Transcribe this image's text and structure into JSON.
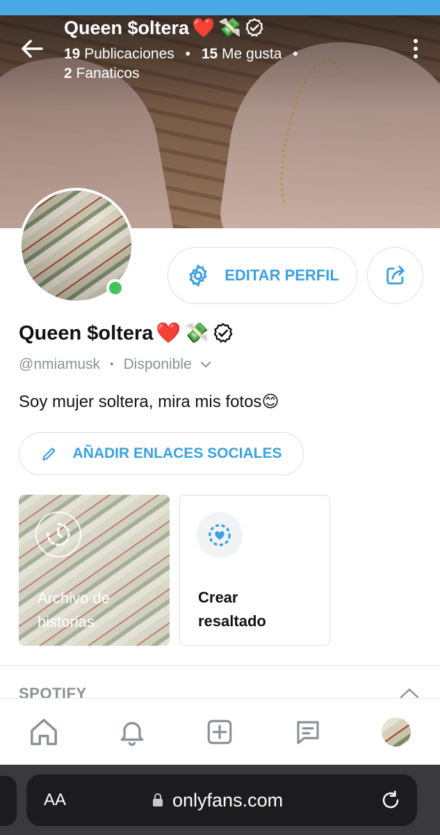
{
  "colors": {
    "accent": "#3ba0e0",
    "online": "#45c45b",
    "muted": "#8a9197"
  },
  "header": {
    "name": "Queen $oltera",
    "posts_count": "19",
    "posts_label": "Publicaciones",
    "likes_count": "15",
    "likes_label": "Me gusta",
    "fans_count": "2",
    "fans_label": "Fanaticos"
  },
  "profile": {
    "name": "Queen $oltera",
    "emoji_heart": "❤️",
    "emoji_money": "💸",
    "handle": "@nmiamusk",
    "status": "Disponible",
    "bio": "Soy mujer soltera, mira mis fotos",
    "bio_emoji": "😊"
  },
  "buttons": {
    "edit_profile": "EDITAR PERFIL",
    "add_social": "AÑADIR ENLACES SOCIALES"
  },
  "cards": {
    "archive_line1": "Archivo de",
    "archive_line2": "historias",
    "highlight_line1": "Crear",
    "highlight_line2": "resaltado"
  },
  "sections": {
    "spotify": "SPOTIFY"
  },
  "nav": [
    "home-icon",
    "bell-icon",
    "add-post-icon",
    "messages-icon",
    "profile-avatar"
  ],
  "browser": {
    "text_size": "AA",
    "url": "onlyfans.com"
  }
}
